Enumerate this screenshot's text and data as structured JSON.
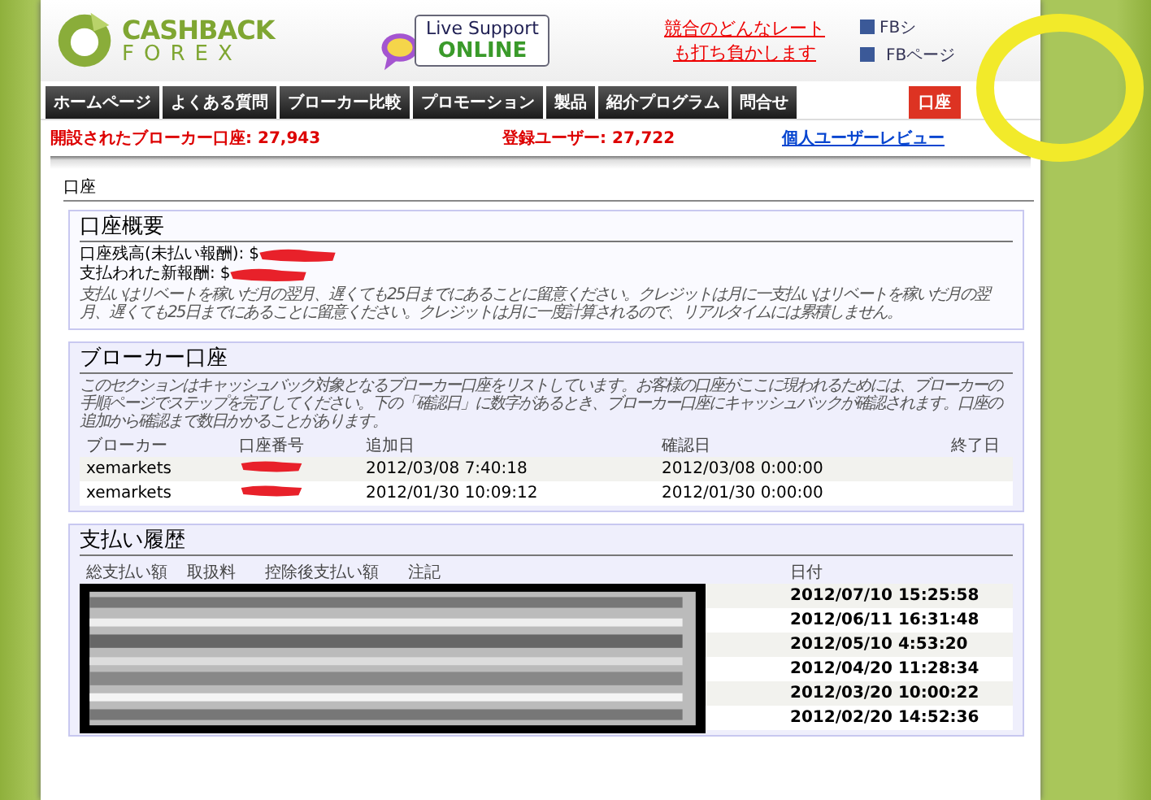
{
  "logo": {
    "line1": "CASHBACK",
    "line2": "FOREX"
  },
  "support": {
    "label": "Live Support",
    "status": "ONLINE"
  },
  "promo": [
    "競合のどんなレート",
    "も打ち負かします"
  ],
  "social": [
    "FBシ",
    "FBページ"
  ],
  "nav": [
    {
      "label": "ホームページ",
      "selected": false
    },
    {
      "label": "よくある質問",
      "selected": false
    },
    {
      "label": "ブローカー比較",
      "selected": false
    },
    {
      "label": "プロモーション",
      "selected": false
    },
    {
      "label": "製品",
      "selected": false
    },
    {
      "label": "紹介プログラム",
      "selected": false
    },
    {
      "label": "問合せ",
      "selected": false
    }
  ],
  "account_tab": {
    "label": "口座"
  },
  "stats": [
    {
      "label": "開設されたブローカー口座:",
      "value": "27,943"
    },
    {
      "label": "登録ユーザー:",
      "value": "27,722"
    }
  ],
  "review_link": "個人ユーザーレビュー",
  "page_title": "口座",
  "summary": {
    "title": "口座概要",
    "fields": [
      {
        "label": "口座残高(未払い報酬):",
        "value": "$"
      },
      {
        "label": "支払われた新報酬:",
        "value": "$"
      }
    ],
    "note": "支払いはリベートを稼いだ月の翌月、遅くても25日までにあることに留意ください。クレジットは月に一支払いはリベートを稼いだ月の翌月、遅くても25日までにあることに留意ください。クレジットは月に一度計算されるので、リアルタイムには累積しません。"
  },
  "brokers": {
    "title": "ブローカー口座",
    "note": "このセクションはキャッシュバック対象となるブローカー口座をリストしています。お客様の口座がここに現われるためには、ブローカーの手順ページでステップを完了してください。下の「確認日」に数字があるとき、ブローカー口座にキャッシュバックが確認されます。口座の追加から確認まで数日かかることがあります。",
    "columns": [
      "ブローカー",
      "口座番号",
      "追加日",
      "確認日",
      "終了日"
    ],
    "rows": [
      {
        "broker": "xemarkets",
        "added": "2012/03/08 7:40:18",
        "confirmed": "2012/03/08 0:00:00"
      },
      {
        "broker": "xemarkets",
        "added": "2012/01/30 10:09:12",
        "confirmed": "2012/01/30 0:00:00"
      }
    ]
  },
  "payments": {
    "title": "支払い履歴",
    "columns": [
      "総支払い額",
      "取扱料",
      "控除後支払い額",
      "注記",
      "日付"
    ],
    "rows": [
      {
        "date": "2012/07/10 15:25:58"
      },
      {
        "date": "2012/06/11 16:31:48"
      },
      {
        "date": "2012/05/10 4:53:20"
      },
      {
        "date": "2012/04/20 11:28:34"
      },
      {
        "date": "2012/03/20 10:00:22"
      },
      {
        "date": "2012/02/20 14:52:36"
      }
    ]
  }
}
